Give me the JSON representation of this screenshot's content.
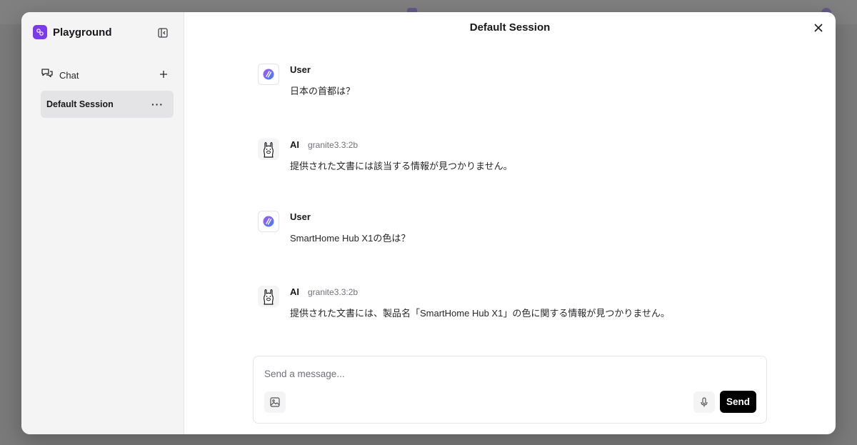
{
  "sidebar": {
    "brand_title": "Playground",
    "chat_label": "Chat",
    "sessions": [
      {
        "label": "Default Session",
        "more": "···"
      }
    ]
  },
  "main": {
    "title": "Default Session",
    "messages": [
      {
        "role": "User",
        "model": "",
        "text": "日本の首都は？"
      },
      {
        "role": "AI",
        "model": "granite3.3:2b",
        "text": "提供された文書には該当する情報が見つかりません。"
      },
      {
        "role": "User",
        "model": "",
        "text": "SmartHome Hub X1の色は？"
      },
      {
        "role": "AI",
        "model": "granite3.3:2b",
        "text": "提供された文書には、製品名「SmartHome Hub X1」の色に関する情報が見つかりません。"
      }
    ]
  },
  "composer": {
    "placeholder": "Send a message...",
    "send_label": "Send"
  },
  "colors": {
    "accent": "#7c3aed",
    "send_bg": "#000000",
    "sidebar_bg": "#f4f4f5",
    "active_session_bg": "#e4e4e7"
  },
  "icons": {
    "brand": "playground-logo-icon",
    "collapse": "sidebar-collapse-icon",
    "chat": "chat-bubbles-icon",
    "new_chat": "plus-icon",
    "close": "close-icon",
    "user_avatar": "user-avatar-icon",
    "ai_avatar": "llama-icon",
    "image": "image-icon",
    "mic": "microphone-icon"
  }
}
